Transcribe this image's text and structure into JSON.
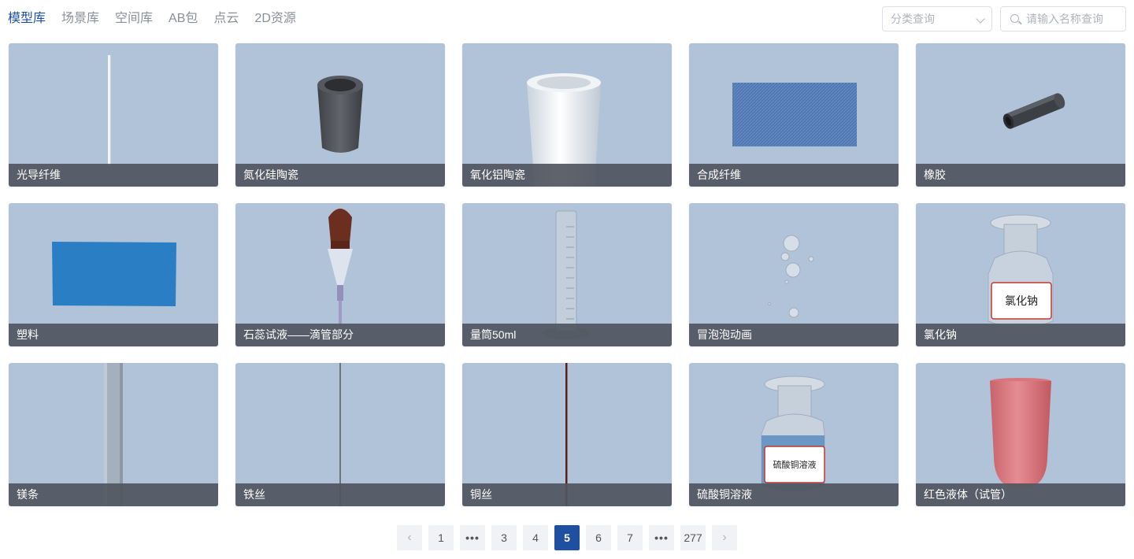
{
  "tabs": [
    "模型库",
    "场景库",
    "空间库",
    "AB包",
    "点云",
    "2D资源"
  ],
  "filter": {
    "placeholder": "分类查询"
  },
  "search": {
    "placeholder": "请输入名称查询"
  },
  "cards": [
    {
      "label": "光导纤维",
      "icon": "fiber-rod-icon"
    },
    {
      "label": "氮化硅陶瓷",
      "icon": "dark-cylinder-icon"
    },
    {
      "label": "氧化铝陶瓷",
      "icon": "white-cylinder-icon"
    },
    {
      "label": "合成纤维",
      "icon": "fabric-swatch-icon"
    },
    {
      "label": "橡胶",
      "icon": "rubber-tube-icon"
    },
    {
      "label": "塑料",
      "icon": "plastic-sheet-icon"
    },
    {
      "label": "石蕊试液——滴管部分",
      "icon": "dropper-icon"
    },
    {
      "label": "量筒50ml",
      "icon": "graduated-cylinder-icon"
    },
    {
      "label": "冒泡泡动画",
      "icon": "bubbles-icon"
    },
    {
      "label": "氯化钠",
      "icon": "reagent-bottle-icon",
      "bottle_label": "氯化钠"
    },
    {
      "label": "镁条",
      "icon": "magnesium-strip-icon"
    },
    {
      "label": "铁丝",
      "icon": "iron-wire-icon"
    },
    {
      "label": "铜丝",
      "icon": "copper-wire-icon"
    },
    {
      "label": "硫酸铜溶液",
      "icon": "blue-solution-bottle-icon",
      "bottle_label": "硫酸铜溶液"
    },
    {
      "label": "红色液体（试管）",
      "icon": "red-test-tube-icon"
    }
  ],
  "pagination": {
    "items": [
      "1",
      "•••",
      "3",
      "4",
      "5",
      "6",
      "7",
      "•••",
      "277"
    ],
    "current": "5"
  },
  "colors": {
    "accent": "#1f4fa0",
    "card_bg": "#b1c3d9"
  }
}
